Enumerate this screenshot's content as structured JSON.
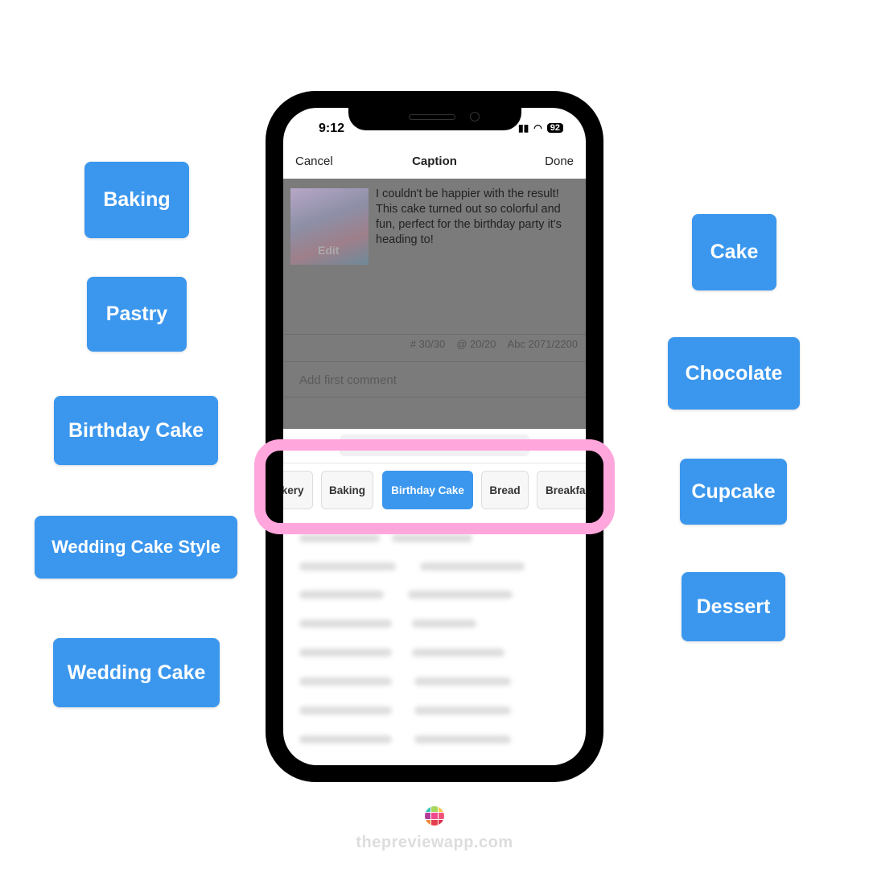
{
  "left_tags": [
    "Baking",
    "Pastry",
    "Birthday Cake",
    "Wedding Cake Style",
    "Wedding Cake"
  ],
  "right_tags": [
    "Cake",
    "Chocolate",
    "Cupcake",
    "Dessert"
  ],
  "status": {
    "time": "9:12",
    "battery": "92"
  },
  "nav": {
    "cancel": "Cancel",
    "title": "Caption",
    "done": "Done"
  },
  "post": {
    "edit_label": "Edit",
    "caption": "I couldn't be happier with the result! This cake turned out so colorful and fun, perfect for the birthday party it's heading to!",
    "hashtag_count": "# 30/30",
    "mention_count": "@ 20/20",
    "char_count": "Abc 2071/2200",
    "comment_placeholder": "Add first comment"
  },
  "chips": [
    {
      "label": "Bakery",
      "shown": "kery"
    },
    {
      "label": "Baking"
    },
    {
      "label": "Birthday Cake",
      "selected": true
    },
    {
      "label": "Bread"
    },
    {
      "label": "Breakfast",
      "shown": "Breakfa"
    }
  ],
  "footer": {
    "brand": "thepreviewapp.com"
  },
  "colors": {
    "tag": "#3b97ee",
    "highlight": "#ffa6dc"
  }
}
